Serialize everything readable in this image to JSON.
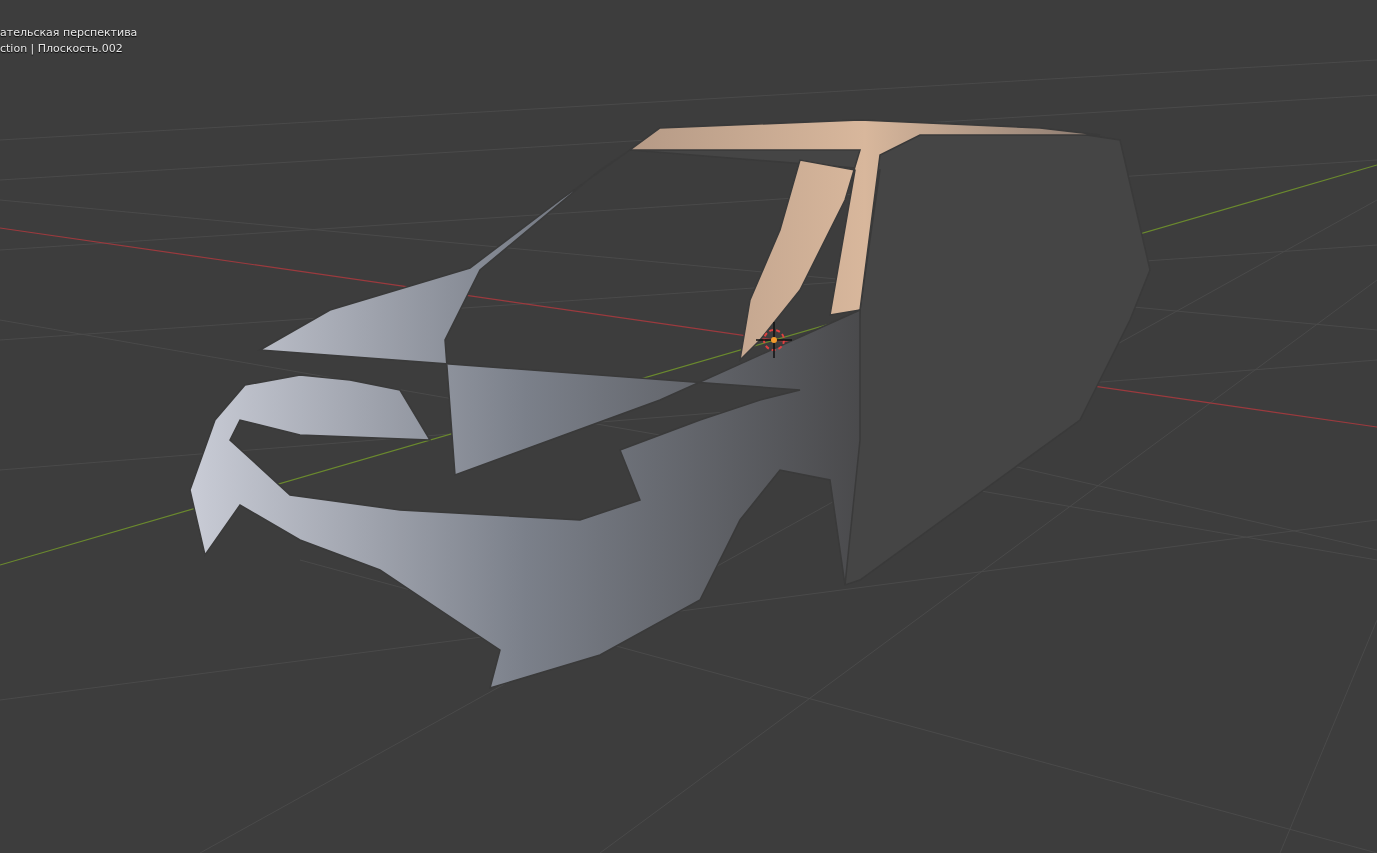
{
  "viewport": {
    "view_name": "ательская перспектива",
    "object_path": "ction | Плоскость.002"
  }
}
